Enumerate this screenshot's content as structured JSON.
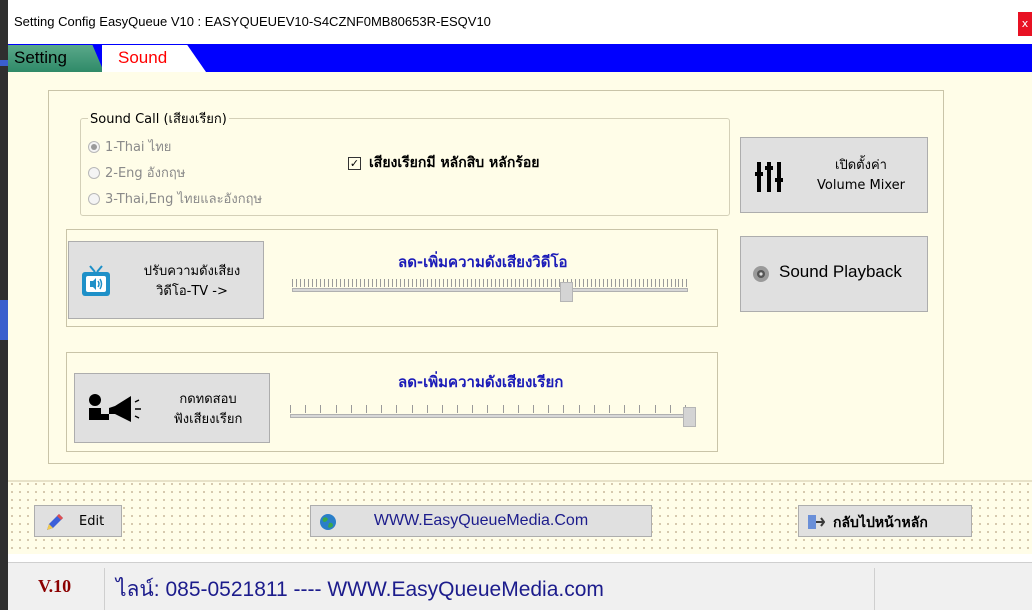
{
  "window": {
    "title": "Setting Config EasyQueue V10 : EASYQUEUEV10-S4CZNF0MB80653R-ESQV10",
    "close_label": "x"
  },
  "tabs": [
    {
      "label": "Setting",
      "active": false
    },
    {
      "label": "Sound",
      "active": true
    }
  ],
  "sound_call": {
    "legend": "Sound Call (เสียงเรียก)",
    "options": [
      {
        "label": "1-Thai ไทย",
        "selected": true
      },
      {
        "label": "2-Eng อังกฤษ",
        "selected": false
      },
      {
        "label": "3-Thai,Eng ไทยและอังกฤษ",
        "selected": false
      }
    ],
    "checkbox_mark": "✓",
    "checkbox_label": "เสียงเรียกมี หลักสิบ หลักร้อย",
    "checkbox_checked": true
  },
  "buttons": {
    "volume_mixer_line1": "เปิดตั้งค่า",
    "volume_mixer_line2": "Volume Mixer",
    "sound_playback": "Sound Playback",
    "video_tv_line1": "ปรับความดังเสียง",
    "video_tv_line2": "วิดีโอ-TV ->",
    "test_call_line1": "กดทดสอบ",
    "test_call_line2": "ฟังเสียงเรียก"
  },
  "sliders": {
    "video_title": "ลด-เพิ่มความดังเสียงวิดีโอ",
    "video_level": 0.7,
    "call_title": "ลด-เพิ่มความดังเสียงเรียก",
    "call_level": 1.0
  },
  "bottom": {
    "edit_label": "Edit",
    "website_label": "WWW.EasyQueueMedia.Com",
    "back_label": "กลับไปหน้าหลัก"
  },
  "status": {
    "version": "V.10",
    "contact": "ไลน์: 085-0521811 ---- WWW.EasyQueueMedia.com"
  },
  "colors": {
    "tab_strip": "#0000ff",
    "active_tab_text": "#ff0000",
    "slider_title": "#1c1cb8",
    "status_version": "#8b0000"
  }
}
